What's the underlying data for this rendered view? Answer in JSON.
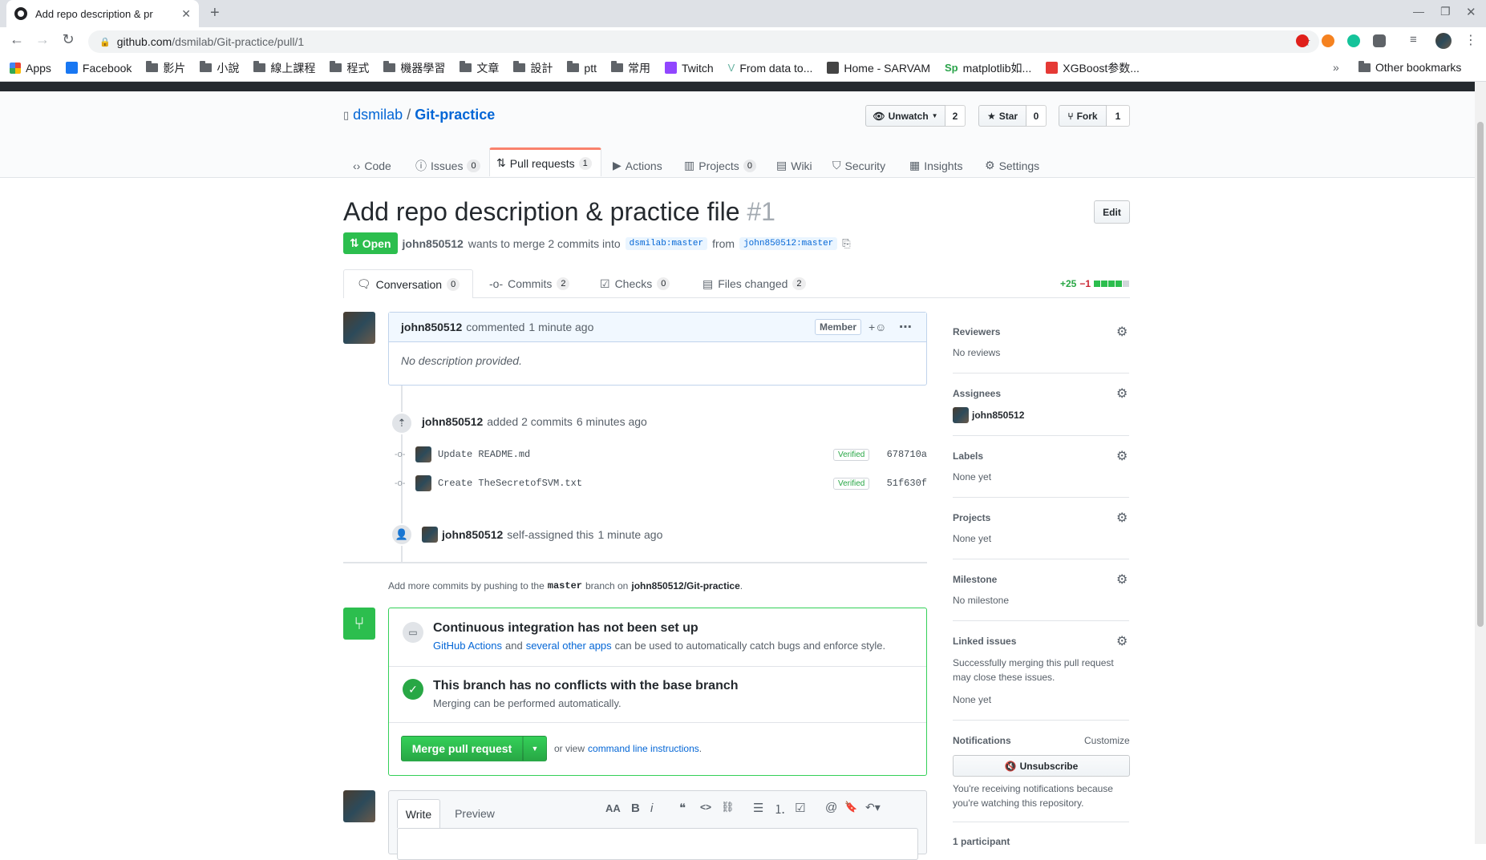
{
  "browser": {
    "tab_title": "Add repo description & pr",
    "url_host": "github.com",
    "url_path": "/dsmilab/Git-practice/pull/1",
    "bookmarks": [
      "Apps",
      "Facebook",
      "影片",
      "小說",
      "線上課程",
      "程式",
      "機器學習",
      "文章",
      "設計",
      "ptt",
      "常用",
      "Twitch",
      "From data to...",
      "Home - SARVAM",
      "matplotlib如...",
      "XGBoost参数...",
      "Other bookmarks"
    ]
  },
  "repo": {
    "owner": "dsmilab",
    "separator": "/",
    "name": "Git-practice",
    "unwatch_label": "Unwatch",
    "unwatch_count": "2",
    "star_label": "Star",
    "star_count": "0",
    "fork_label": "Fork",
    "fork_count": "1",
    "tabs": [
      {
        "label": "Code",
        "count": ""
      },
      {
        "label": "Issues",
        "count": "0"
      },
      {
        "label": "Pull requests",
        "count": "1"
      },
      {
        "label": "Actions",
        "count": ""
      },
      {
        "label": "Projects",
        "count": "0"
      },
      {
        "label": "Wiki",
        "count": ""
      },
      {
        "label": "Security",
        "count": ""
      },
      {
        "label": "Insights",
        "count": ""
      },
      {
        "label": "Settings",
        "count": ""
      }
    ]
  },
  "pr": {
    "title": "Add repo description & practice file",
    "number": "#1",
    "edit_label": "Edit",
    "state": "Open",
    "author": "john850512",
    "merge_text": "wants to merge 2 commits into",
    "base_branch": "dsmilab:master",
    "from_text": "from",
    "head_branch": "john850512:master",
    "tabs": [
      {
        "label": "Conversation",
        "count": "0"
      },
      {
        "label": "Commits",
        "count": "2"
      },
      {
        "label": "Checks",
        "count": "0"
      },
      {
        "label": "Files changed",
        "count": "2"
      }
    ],
    "additions": "+25",
    "deletions": "−1"
  },
  "comment": {
    "author": "john850512",
    "action": "commented",
    "time": "1 minute ago",
    "role_badge": "Member",
    "reaction_label": "+☺",
    "body": "No description provided."
  },
  "timeline": {
    "commits_author": "john850512",
    "commits_text": "added 2 commits",
    "commits_time": "6 minutes ago",
    "commits": [
      {
        "message": "Update README.md",
        "verified": "Verified",
        "sha": "678710a"
      },
      {
        "message": "Create TheSecretofSVM.txt",
        "verified": "Verified",
        "sha": "51f630f"
      }
    ],
    "assign_author": "john850512",
    "assign_text": "self-assigned this",
    "assign_time": "1 minute ago"
  },
  "hint": {
    "prefix": "Add more commits by pushing to the",
    "branch": "master",
    "middle": "branch on",
    "repo": "john850512/Git-practice",
    "suffix": "."
  },
  "merge_box": {
    "ci_title": "Continuous integration has not been set up",
    "ci_link1": "GitHub Actions",
    "ci_and": "and",
    "ci_link2": "several other apps",
    "ci_rest": "can be used to automatically catch bugs and enforce style.",
    "conflict_title": "This branch has no conflicts with the base branch",
    "conflict_sub": "Merging can be performed automatically.",
    "merge_button": "Merge pull request",
    "or_view": "or view",
    "cli_link": "command line instructions",
    "period": "."
  },
  "editor": {
    "write_tab": "Write",
    "preview_tab": "Preview",
    "toolbar_icons": [
      "text-size-icon",
      "bold-icon",
      "italic-icon",
      "quote-icon",
      "code-icon",
      "link-icon",
      "bullet-list-icon",
      "numbered-list-icon",
      "task-list-icon",
      "mention-icon",
      "reference-icon",
      "reply-icon"
    ],
    "toolbar_glyphs": [
      "AA",
      "B",
      "i",
      "❝",
      "<>",
      "⛓",
      "☰",
      "⒈",
      "☑",
      "@",
      "🔖",
      "↶▾"
    ]
  },
  "sidebar": {
    "reviewers_label": "Reviewers",
    "reviewers_value": "No reviews",
    "assignees_label": "Assignees",
    "assignee_name": "john850512",
    "labels_label": "Labels",
    "labels_value": "None yet",
    "projects_label": "Projects",
    "projects_value": "None yet",
    "milestone_label": "Milestone",
    "milestone_value": "No milestone",
    "linked_label": "Linked issues",
    "linked_desc": "Successfully merging this pull request may close these issues.",
    "linked_value": "None yet",
    "notifications_label": "Notifications",
    "customize_label": "Customize",
    "unsubscribe_label": "Unsubscribe",
    "notif_reason": "You're receiving notifications because you're watching this repository.",
    "participants_label": "1 participant"
  },
  "colors": {
    "accent": "#0366d6",
    "green": "#28a745",
    "red": "#cb2431",
    "tab_orange": "#f9826c"
  }
}
